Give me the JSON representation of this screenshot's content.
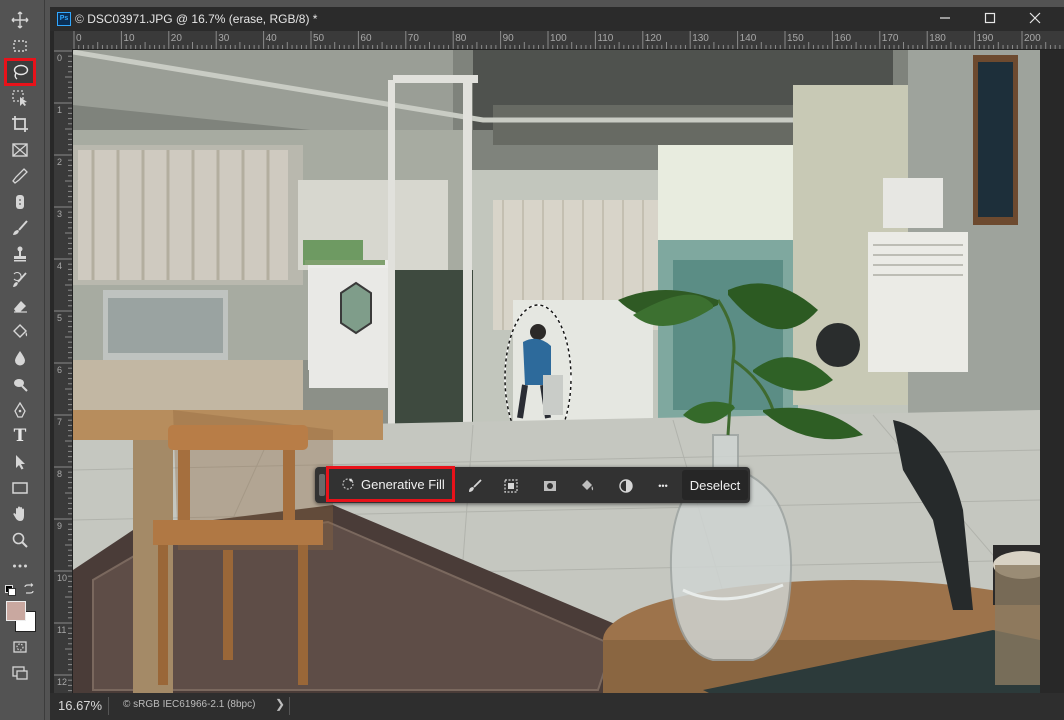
{
  "document": {
    "title": "DSC03971.JPG @ 16.7% (erase, RGB/8) *",
    "app_badge": "Ps"
  },
  "toolbar": {
    "tools": [
      {
        "name": "move-tool",
        "icon": "move-icon"
      },
      {
        "name": "marquee-tool",
        "icon": "rect-marquee-icon"
      },
      {
        "name": "lasso-tool",
        "icon": "lasso-icon",
        "active": true
      },
      {
        "name": "object-selection-tool",
        "icon": "object-selection-icon"
      },
      {
        "name": "crop-tool",
        "icon": "crop-icon"
      },
      {
        "name": "frame-tool",
        "icon": "frame-icon"
      },
      {
        "name": "eyedropper-tool",
        "icon": "eyedropper-icon"
      },
      {
        "name": "spot-healing-tool",
        "icon": "bandage-icon"
      },
      {
        "name": "brush-tool",
        "icon": "brush-icon"
      },
      {
        "name": "clone-stamp-tool",
        "icon": "stamp-icon"
      },
      {
        "name": "history-brush-tool",
        "icon": "history-brush-icon"
      },
      {
        "name": "eraser-tool",
        "icon": "eraser-icon"
      },
      {
        "name": "paint-bucket-tool",
        "icon": "bucket-icon"
      },
      {
        "name": "blur-tool",
        "icon": "drop-icon"
      },
      {
        "name": "dodge-tool",
        "icon": "dodge-icon"
      },
      {
        "name": "pen-tool",
        "icon": "pen-icon"
      },
      {
        "name": "type-tool",
        "icon": "type-icon"
      },
      {
        "name": "path-selection-tool",
        "icon": "arrow-icon"
      },
      {
        "name": "rectangle-tool",
        "icon": "rectangle-icon"
      },
      {
        "name": "hand-tool",
        "icon": "hand-icon"
      },
      {
        "name": "zoom-tool",
        "icon": "zoom-icon"
      },
      {
        "name": "more-tools",
        "icon": "ellipsis-icon"
      }
    ],
    "type_glyph": "T",
    "foreground_color": "#c9a8a0",
    "background_color": "#ffffff"
  },
  "ruler": {
    "top_labels": [
      "0",
      "10",
      "20",
      "30",
      "40",
      "50",
      "60",
      "70",
      "80",
      "90",
      "100",
      "110",
      "120",
      "130",
      "140",
      "150",
      "160",
      "170",
      "180",
      "190",
      "200"
    ],
    "left_labels": [
      "0",
      "1",
      "2",
      "3",
      "4",
      "5",
      "6",
      "7",
      "8",
      "9",
      "10",
      "11",
      "12"
    ]
  },
  "taskbar": {
    "generative_fill_label": "Generative Fill",
    "icons": [
      "brush-mask-icon",
      "invert-selection-icon",
      "mask-icon",
      "fill-icon",
      "adjustment-icon",
      "more-icon"
    ],
    "more_glyph": "•••",
    "deselect_label": "Deselect"
  },
  "status": {
    "zoom": "16.67%",
    "profile": "© sRGB IEC61966-2.1 (8bpc)",
    "arrow": "❯"
  },
  "colors": {
    "highlight": "#e8121a",
    "panel": "#535353",
    "document_bg": "#282828"
  }
}
